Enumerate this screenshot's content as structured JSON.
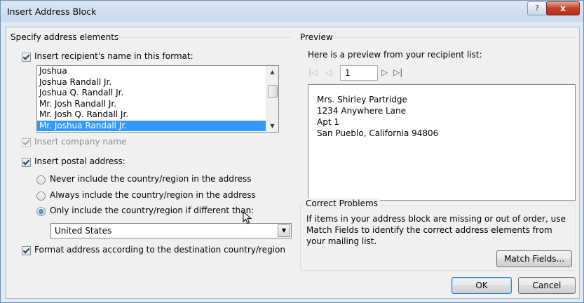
{
  "window": {
    "title": "Insert Address Block",
    "help_glyph": "?",
    "close_glyph": "x"
  },
  "left": {
    "group_title": "Specify address elements",
    "recipient_name": {
      "checked": true,
      "label": "Insert recipient's name in this format:",
      "formats": [
        "Joshua",
        "Joshua Randall Jr.",
        "Joshua Q. Randall Jr.",
        "Mr. Josh Randall Jr.",
        "Mr. Josh Q. Randall Jr.",
        "Mr. Joshua Randall Jr."
      ],
      "selected_format": "Mr. Joshua Randall Jr."
    },
    "company": {
      "checked": true,
      "disabled": true,
      "label": "Insert company name"
    },
    "postal": {
      "checked": true,
      "label": "Insert postal address:",
      "options": [
        {
          "label": "Never include the country/region in the address",
          "selected": false
        },
        {
          "label": "Always include the country/region in the address",
          "selected": false
        },
        {
          "label": "Only include the country/region if different than:",
          "selected": true
        }
      ],
      "country_value": "United States"
    },
    "format_by_destination": {
      "checked": true,
      "label": "Format address according to the destination country/region"
    }
  },
  "preview": {
    "group_title": "Preview",
    "intro": "Here is a preview from your recipient list:",
    "record_number": "1",
    "nav_icons": {
      "first": "first-record-icon",
      "previous": "previous-record-icon",
      "next": "next-record-icon",
      "last": "last-record-icon"
    },
    "address_lines": [
      "Mrs. Shirley Partridge",
      "1234 Anywhere Lane",
      "Apt 1",
      "San Pueblo, California 94806"
    ]
  },
  "correct_problems": {
    "group_title": "Correct Problems",
    "text_lines": [
      "If items in your address block are missing or out of order, use",
      "Match Fields to identify the correct address elements from",
      "your mailing list."
    ],
    "match_fields_label": "Match Fields..."
  },
  "footer": {
    "ok_label": "OK",
    "cancel_label": "Cancel"
  },
  "colors": {
    "selection": "#3399ff",
    "title_bar": "#c9d9ec",
    "close_button": "#c3402a"
  }
}
